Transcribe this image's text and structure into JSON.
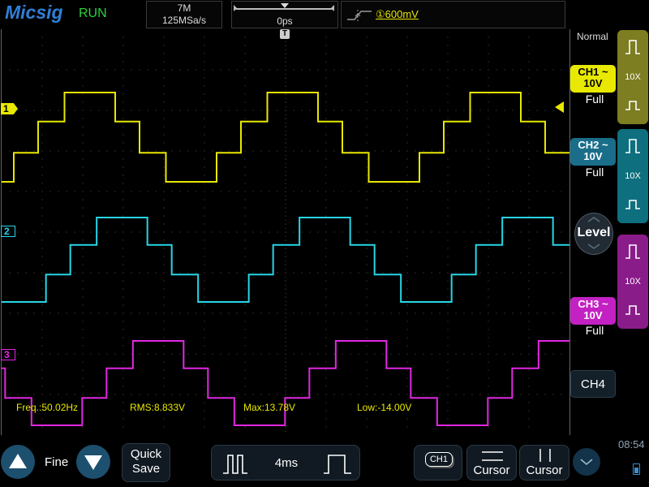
{
  "header": {
    "brand": "Micsig",
    "run_state": "RUN",
    "memory_depth": "7M",
    "sample_rate": "125MSa/s",
    "horizontal_position": "0ps",
    "trigger_source_icon": "ch1-trigger-icon",
    "trigger_level": "①600mV",
    "trigger_mode": "Normal"
  },
  "screen": {
    "trigger_marker": "T",
    "channel_markers": [
      "1",
      "2",
      "3"
    ],
    "measurements": {
      "freq": "Freq.:50.02Hz",
      "rms": "RMS:8.833V",
      "max": "Max:13.78V",
      "low": "Low:-14.00V"
    }
  },
  "channels": [
    {
      "name": "CH1",
      "coupling_icon": "ac-coupling-icon",
      "scale": "10V",
      "bandwidth": "Full",
      "probe": "10X",
      "color": "#e8e800"
    },
    {
      "name": "CH2",
      "coupling_icon": "ac-coupling-icon",
      "scale": "10V",
      "bandwidth": "Full",
      "probe": "10X",
      "color": "#27d6e6"
    },
    {
      "name": "CH3",
      "coupling_icon": "ac-coupling-icon",
      "scale": "10V",
      "bandwidth": "Full",
      "probe": "10X",
      "color": "#e227e2"
    }
  ],
  "right_panel": {
    "level_label": "Level",
    "ch4_label": "CH4"
  },
  "bottom_bar": {
    "fine_label": "Fine",
    "quick_save_line1": "Quick",
    "quick_save_line2": "Save",
    "timebase": "4ms",
    "ch1_badge": "CH1",
    "cursor1_label": "Cursor",
    "cursor2_label": "Cursor",
    "clock": "08:54"
  },
  "colors": {
    "ch1": "#e8e800",
    "ch2": "#27d6e6",
    "ch3": "#e227e2",
    "accent_blue": "#2f7fd6",
    "run_green": "#2bd13b"
  }
}
